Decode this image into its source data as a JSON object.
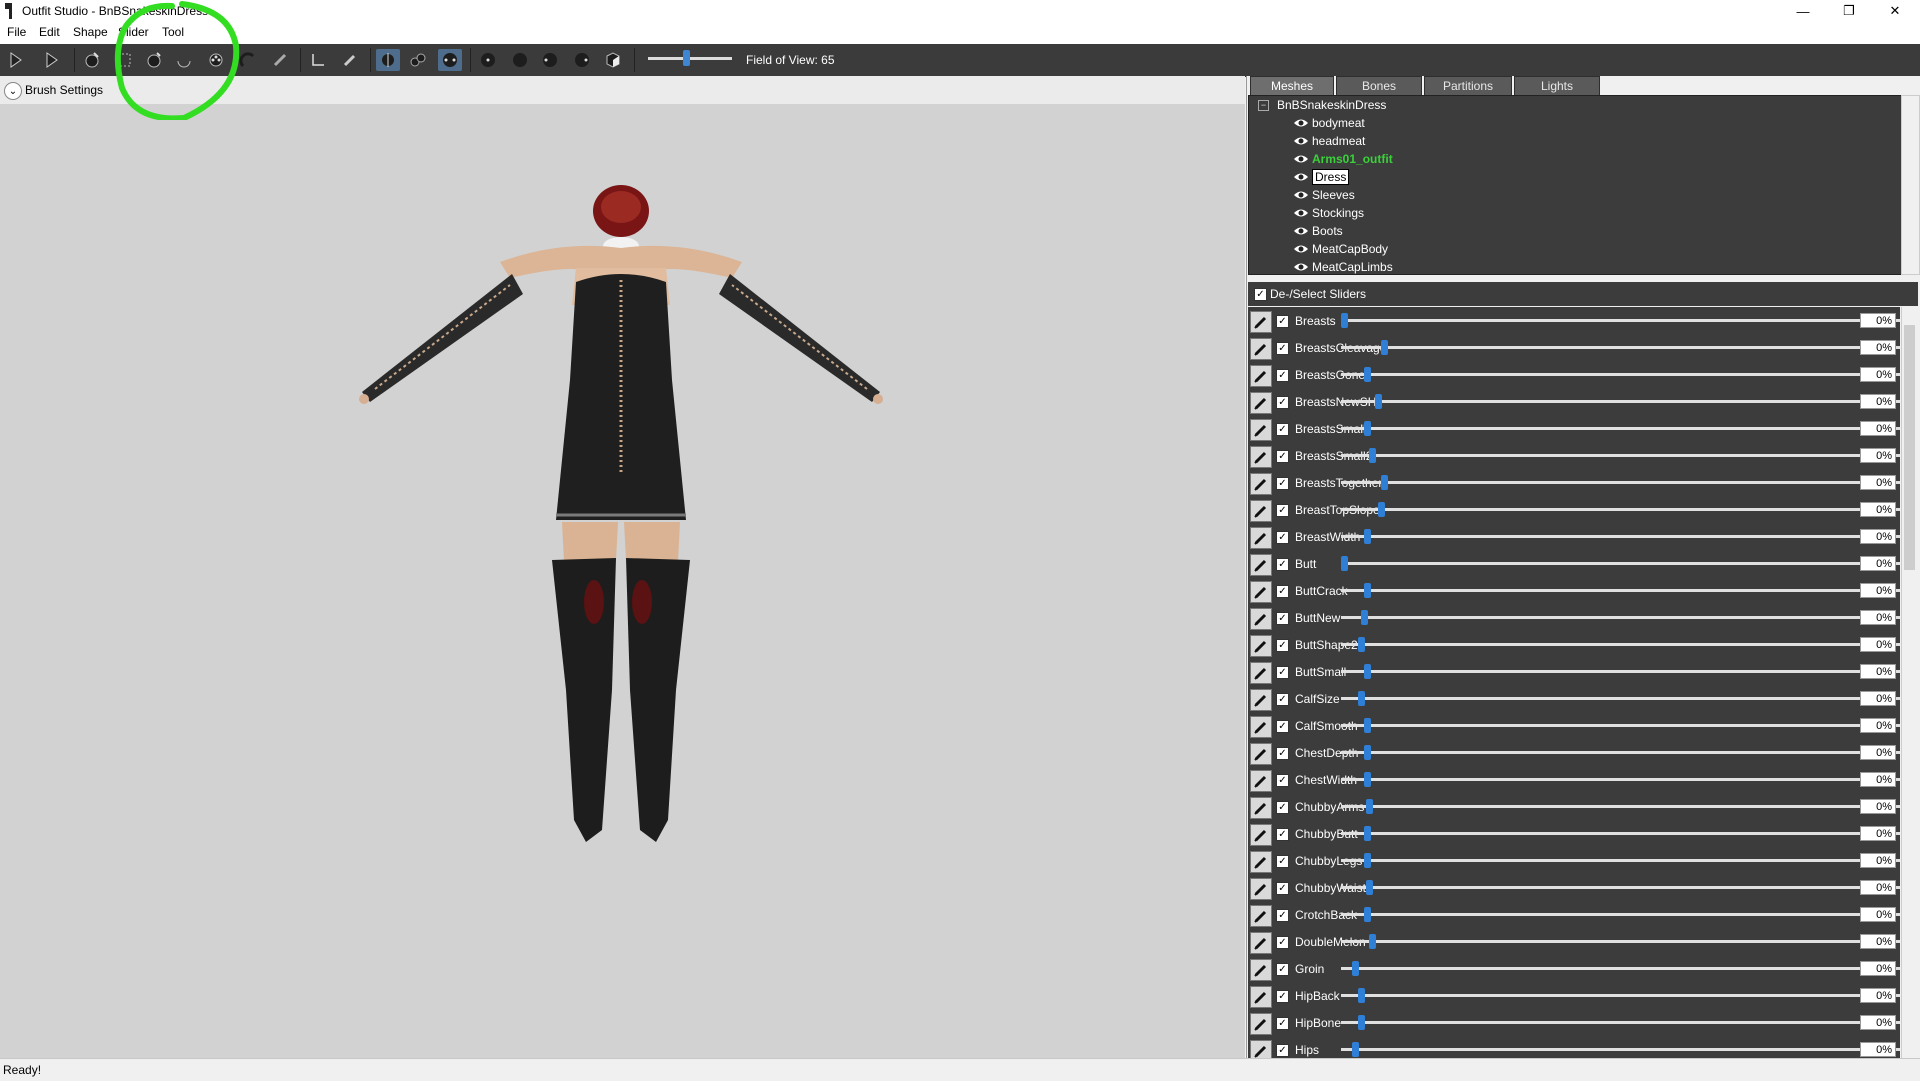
{
  "window": {
    "title": "Outfit Studio - BnBSnakeskinDress",
    "controls": [
      "—",
      "❐",
      "✕"
    ]
  },
  "menu": [
    "File",
    "Edit",
    "Shape",
    "Slider",
    "Tool"
  ],
  "toolbar": {
    "field_of_view_label": "Field of View: 65",
    "field_of_view_value": 65
  },
  "viewport": {
    "brush_settings_label": "Brush Settings"
  },
  "tabs": [
    "Meshes",
    "Bones",
    "Partitions",
    "Lights"
  ],
  "mesh_tree": {
    "root": "BnBSnakeskinDress",
    "items": [
      {
        "label": "bodymeat"
      },
      {
        "label": "headmeat"
      },
      {
        "label": "Arms01_outfit",
        "highlight": "green"
      },
      {
        "label": "Dress",
        "selected": true
      },
      {
        "label": "Sleeves"
      },
      {
        "label": "Stockings"
      },
      {
        "label": "Boots"
      },
      {
        "label": "MeatCapBody"
      },
      {
        "label": "MeatCapLimbs"
      }
    ]
  },
  "sliders_header": "De-/Select Sliders",
  "sliders": [
    {
      "name": "Breasts",
      "value": "0%",
      "thumb": 0.0
    },
    {
      "name": "BreastsCleavage",
      "value": "0%",
      "thumb": 0.07
    },
    {
      "name": "BreastsGone",
      "value": "0%",
      "thumb": 0.04
    },
    {
      "name": "BreastsNewSH",
      "value": "0%",
      "thumb": 0.06
    },
    {
      "name": "BreastsSmall",
      "value": "0%",
      "thumb": 0.04
    },
    {
      "name": "BreastsSmall2",
      "value": "0%",
      "thumb": 0.05
    },
    {
      "name": "BreastsTogether",
      "value": "0%",
      "thumb": 0.07
    },
    {
      "name": "BreastTopSlope",
      "value": "0%",
      "thumb": 0.066
    },
    {
      "name": "BreastWidth",
      "value": "0%",
      "thumb": 0.04
    },
    {
      "name": "Butt",
      "value": "0%",
      "thumb": 0.0
    },
    {
      "name": "ButtCrack",
      "value": "0%",
      "thumb": 0.04
    },
    {
      "name": "ButtNew",
      "value": "0%",
      "thumb": 0.035
    },
    {
      "name": "ButtShape2",
      "value": "0%",
      "thumb": 0.03
    },
    {
      "name": "ButtSmall",
      "value": "0%",
      "thumb": 0.04
    },
    {
      "name": "CalfSize",
      "value": "0%",
      "thumb": 0.03
    },
    {
      "name": "CalfSmooth",
      "value": "0%",
      "thumb": 0.04
    },
    {
      "name": "ChestDepth",
      "value": "0%",
      "thumb": 0.04
    },
    {
      "name": "ChestWidth",
      "value": "0%",
      "thumb": 0.04
    },
    {
      "name": "ChubbyArms",
      "value": "0%",
      "thumb": 0.045
    },
    {
      "name": "ChubbyButt",
      "value": "0%",
      "thumb": 0.04
    },
    {
      "name": "ChubbyLegs",
      "value": "0%",
      "thumb": 0.04
    },
    {
      "name": "ChubbyWaist",
      "value": "0%",
      "thumb": 0.045
    },
    {
      "name": "CrotchBack",
      "value": "0%",
      "thumb": 0.04
    },
    {
      "name": "DoubleMelon",
      "value": "0%",
      "thumb": 0.05
    },
    {
      "name": "Groin",
      "value": "0%",
      "thumb": 0.02
    },
    {
      "name": "HipBack",
      "value": "0%",
      "thumb": 0.03
    },
    {
      "name": "HipBone",
      "value": "0%",
      "thumb": 0.03
    },
    {
      "name": "Hips",
      "value": "0%",
      "thumb": 0.02
    }
  ],
  "status": "Ready!",
  "colors": {
    "panel_dark": "#3c3c3c",
    "slider_thumb": "#2f7fd6",
    "annotation": "#33dd22",
    "mesh_highlight": "#3ad13a"
  }
}
